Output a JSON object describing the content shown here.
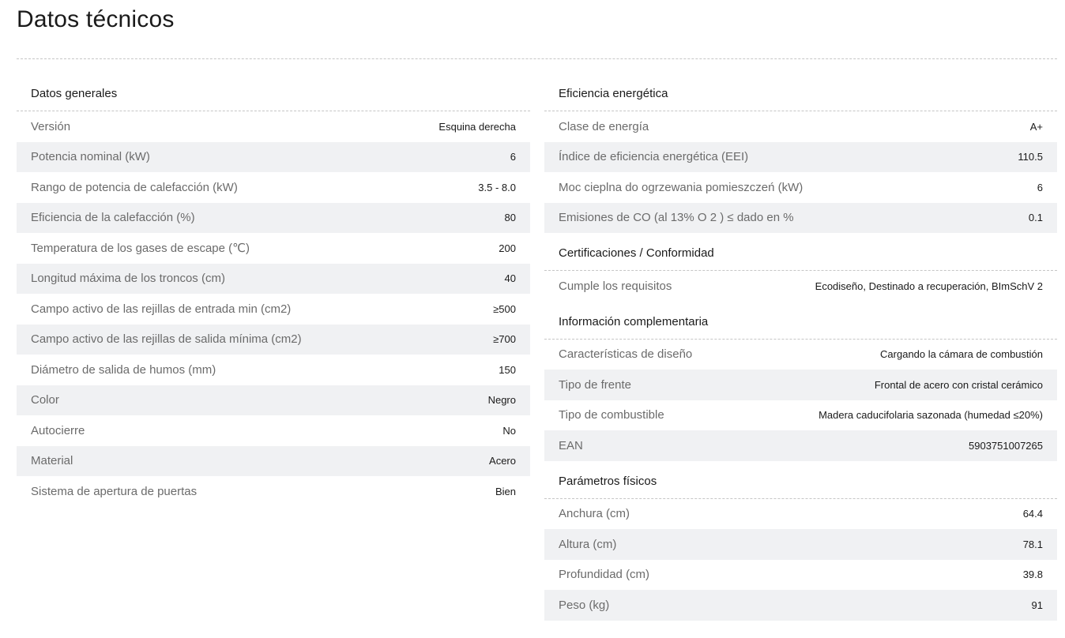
{
  "page": {
    "title": "Datos técnicos"
  },
  "left": {
    "title": "Datos generales",
    "rows": [
      {
        "label": "Versión",
        "value": "Esquina derecha"
      },
      {
        "label": "Potencia nominal (kW)",
        "value": "6"
      },
      {
        "label": "Rango de potencia de calefacción (kW)",
        "value": "3.5 - 8.0"
      },
      {
        "label": "Eficiencia de la calefacción (%)",
        "value": "80"
      },
      {
        "label": "Temperatura de los gases de escape (℃)",
        "value": "200"
      },
      {
        "label": "Longitud máxima de los troncos (cm)",
        "value": "40"
      },
      {
        "label": "Campo activo de las rejillas de entrada min (cm2)",
        "value": "≥500"
      },
      {
        "label": "Campo activo de las rejillas de salida mínima (cm2)",
        "value": "≥700"
      },
      {
        "label": "Diámetro de salida de humos (mm)",
        "value": "150"
      },
      {
        "label": "Color",
        "value": "Negro"
      },
      {
        "label": "Autocierre",
        "value": "No"
      },
      {
        "label": "Material",
        "value": "Acero"
      },
      {
        "label": "Sistema de apertura de puertas",
        "value": "Bien"
      }
    ]
  },
  "right": [
    {
      "title": "Eficiencia energética",
      "rows": [
        {
          "label": "Clase de energía",
          "value": "A+"
        },
        {
          "label": "Índice de eficiencia energética (EEI)",
          "value": "110.5"
        },
        {
          "label": "Moc cieplna do ogrzewania pomieszczeń (kW)",
          "value": "6"
        },
        {
          "label": "Emisiones de CO (al 13% O 2 ) ≤ dado en %",
          "value": "0.1"
        }
      ]
    },
    {
      "title": "Certificaciones / Conformidad",
      "rows": [
        {
          "label": "Cumple los requisitos",
          "value": "Ecodiseño, Destinado a recuperación, BImSchV 2"
        }
      ]
    },
    {
      "title": "Información complementaria",
      "rows": [
        {
          "label": "Características de diseño",
          "value": "Cargando la cámara de combustión"
        },
        {
          "label": "Tipo de frente",
          "value": "Frontal de acero con cristal cerámico"
        },
        {
          "label": "Tipo de combustible",
          "value": "Madera caducifolaria sazonada (humedad ≤20%)"
        },
        {
          "label": "EAN",
          "value": "5903751007265"
        }
      ]
    },
    {
      "title": "Parámetros físicos",
      "rows": [
        {
          "label": "Anchura (cm)",
          "value": "64.4"
        },
        {
          "label": "Altura (cm)",
          "value": "78.1"
        },
        {
          "label": "Profundidad (cm)",
          "value": "39.8"
        },
        {
          "label": "Peso (kg)",
          "value": "91"
        }
      ]
    }
  ]
}
